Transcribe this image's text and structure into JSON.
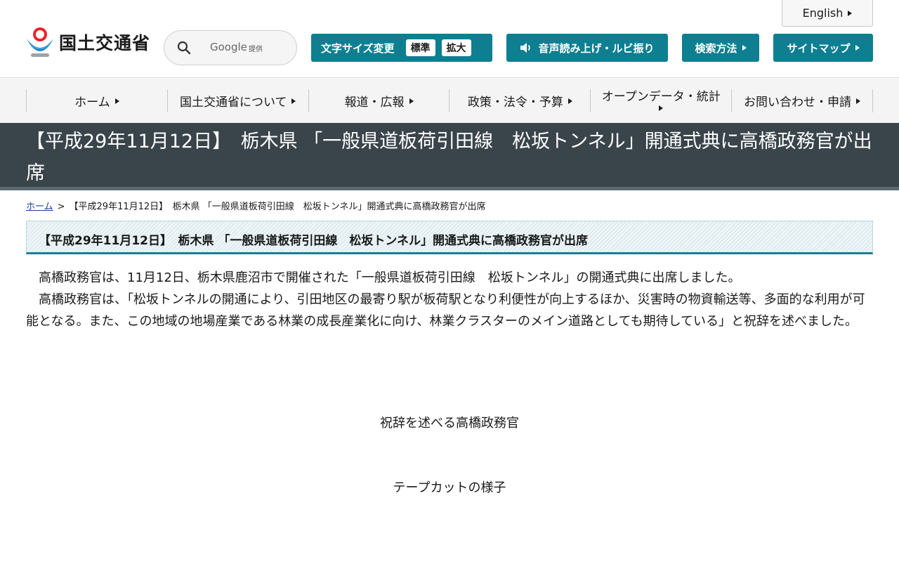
{
  "header": {
    "english_label": "English",
    "logo_text": "国土交通省",
    "search": {
      "placeholder": "",
      "provider": "Google",
      "provided_label": "提供"
    },
    "font_size": {
      "label": "文字サイズ変更",
      "standard_label": "標準",
      "large_label": "拡大"
    },
    "voice_label": "音声読み上げ・ルビ振り",
    "search_howto_label": "検索方法",
    "sitemap_label": "サイトマップ"
  },
  "nav": {
    "items": [
      {
        "label": "ホーム"
      },
      {
        "label": "国土交通省について"
      },
      {
        "label": "報道・広報"
      },
      {
        "label": "政策・法令・予算"
      },
      {
        "label": "オープンデータ・統計"
      },
      {
        "label": "お問い合わせ・申請"
      }
    ]
  },
  "page": {
    "title": "【平成29年11月12日】　栃木県 「一般県道板荷引田線　松坂トンネル」開通式典に高橋政務官が出席",
    "breadcrumb": {
      "home_label": "ホーム",
      "separator": ">",
      "current": "【平成29年11月12日】　栃木県 「一般県道板荷引田線　松坂トンネル」開通式典に高橋政務官が出席"
    },
    "heading": "【平成29年11月12日】　栃木県 「一般県道板荷引田線　松坂トンネル」開通式典に高橋政務官が出席",
    "paragraphs": [
      "高橋政務官は、11月12日、栃木県鹿沼市で開催された「一般県道板荷引田線　松坂トンネル」の開通式典に出席しました。",
      "高橋政務官は、「松坂トンネルの開通により、引田地区の最寄り駅が板荷駅となり利便性が向上するほか、災害時の物資輸送等、多面的な利用が可能となる。また、この地域の地場産業である林業の成長産業化に向け、林業クラスターのメイン道路としても期待している」と祝辞を述べました。"
    ],
    "captions": [
      "祝辞を述べる高橋政務官",
      "テープカットの様子"
    ]
  },
  "colors": {
    "accent_teal": "#0e7f91",
    "title_bar_bg": "#3a444b",
    "nav_bg": "#f4f4f4"
  }
}
